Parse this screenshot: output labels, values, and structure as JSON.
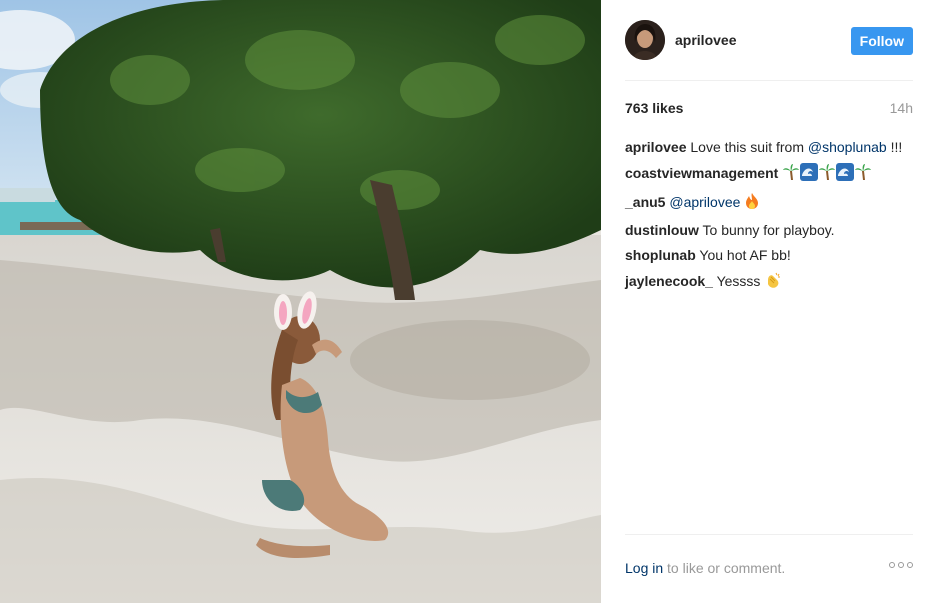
{
  "post": {
    "username": "aprilovee",
    "follow_label": "Follow",
    "likes": "763 likes",
    "time": "14h",
    "comments": [
      {
        "user": "aprilovee",
        "text": "Love this suit from",
        "mention": "@shoplunab",
        "after": " !!!",
        "emoji": []
      },
      {
        "user": "coastviewmanagement",
        "text": "",
        "mention": "",
        "after": "",
        "emoji": [
          "palm-tree",
          "wave",
          "palm-tree",
          "wave",
          "palm-tree"
        ]
      },
      {
        "user": "_anu5",
        "text": "",
        "mention": "@aprilovee",
        "after": "",
        "emoji": [
          "fire"
        ]
      },
      {
        "user": "dustinlouw",
        "text": "To bunny for playboy.",
        "mention": "",
        "after": "",
        "emoji": []
      },
      {
        "user": "shoplunab",
        "text": "You hot AF bb!",
        "mention": "",
        "after": "",
        "emoji": []
      },
      {
        "user": "jaylenecook_",
        "text": "Yessss",
        "mention": "",
        "after": "",
        "emoji": [
          "clapping-hands"
        ]
      }
    ],
    "login_link": "Log in",
    "login_rest": " to like or comment."
  },
  "colors": {
    "follow_button": "#3897f0",
    "mention": "#003569",
    "muted_text": "#999999"
  }
}
